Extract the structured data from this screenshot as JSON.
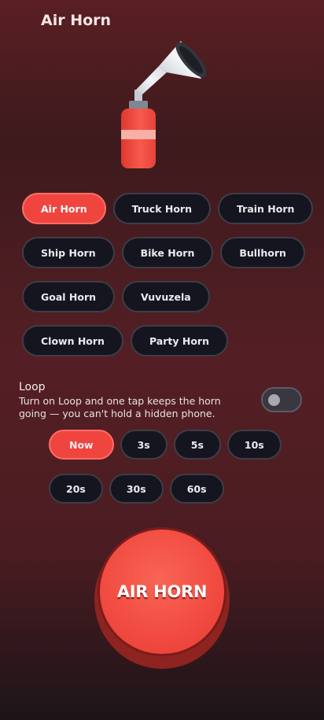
{
  "app": {
    "title": "Air Horn"
  },
  "illustration": {
    "icon": "air-horn-canister-icon"
  },
  "sounds": [
    {
      "label": "Air Horn",
      "selected": true
    },
    {
      "label": "Truck Horn",
      "selected": false
    },
    {
      "label": "Train Horn",
      "selected": false
    },
    {
      "label": "Ship Horn",
      "selected": false
    },
    {
      "label": "Bike Horn",
      "selected": false
    },
    {
      "label": "Bullhorn",
      "selected": false
    },
    {
      "label": "Goal Horn",
      "selected": false
    },
    {
      "label": "Vuvuzela",
      "selected": false
    },
    {
      "label": "Clown Horn",
      "selected": false
    },
    {
      "label": "Party Horn",
      "selected": false
    }
  ],
  "loop": {
    "label": "Loop",
    "description": "Turn on Loop and one tap keeps the horn going — you can't hold a hidden phone.",
    "enabled": false
  },
  "timers": [
    {
      "label": "Now",
      "selected": true
    },
    {
      "label": "3s",
      "selected": false
    },
    {
      "label": "5s",
      "selected": false
    },
    {
      "label": "10s",
      "selected": false
    },
    {
      "label": "20s",
      "selected": false
    },
    {
      "label": "30s",
      "selected": false
    },
    {
      "label": "60s",
      "selected": false
    }
  ],
  "main_button": {
    "label": "AIR HORN"
  },
  "colors": {
    "accent": "#f0453f",
    "chip_bg": "#15151f",
    "chip_border": "#3e3d48"
  }
}
